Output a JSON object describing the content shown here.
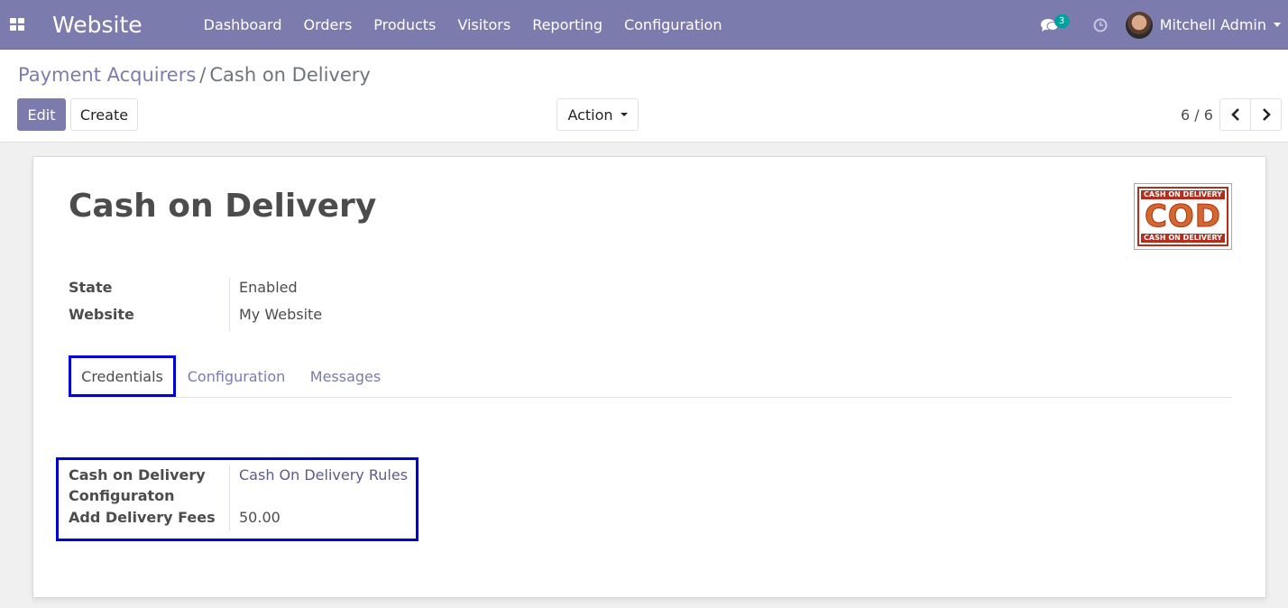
{
  "navbar": {
    "brand": "Website",
    "menu": [
      "Dashboard",
      "Orders",
      "Products",
      "Visitors",
      "Reporting",
      "Configuration"
    ],
    "chat_count": "3",
    "user_name": "Mitchell Admin",
    "color": "#7c7bad"
  },
  "breadcrumb": {
    "parent": "Payment Acquirers",
    "separator": "/",
    "current": "Cash on Delivery"
  },
  "buttons": {
    "edit": "Edit",
    "create": "Create",
    "action": "Action"
  },
  "pager": {
    "value": "6 / 6"
  },
  "record": {
    "title": "Cash on Delivery",
    "logo": {
      "top_text": "CASH ON DELIVERY",
      "big_text": "COD",
      "bottom_text": "CASH ON DELIVERY"
    },
    "fields": [
      {
        "label": "State",
        "value": "Enabled"
      },
      {
        "label": "Website",
        "value": "My Website"
      }
    ]
  },
  "tabs": [
    "Credentials",
    "Configuration",
    "Messages"
  ],
  "credentials": {
    "config_label_line1": "Cash on Delivery",
    "config_label_line2": "Configuraton",
    "config_value": "Cash On Delivery Rules",
    "fees_label": "Add Delivery Fees",
    "fees_value": "50.00"
  },
  "colors": {
    "accent": "#7c7bad",
    "highlight_box": "#0000dd"
  }
}
